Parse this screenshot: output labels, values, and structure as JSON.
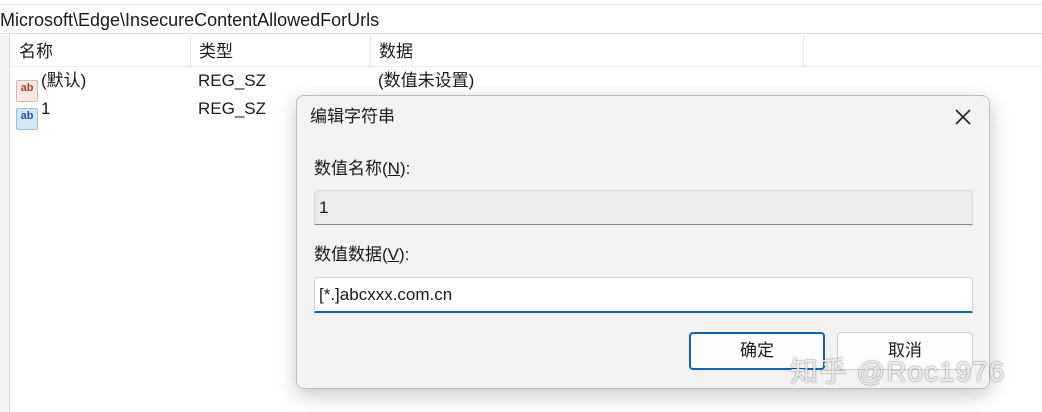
{
  "path": "Microsoft\\Edge\\InsecureContentAllowedForUrls",
  "list": {
    "headers": {
      "name": "名称",
      "type": "类型",
      "data": "数据"
    },
    "rows": [
      {
        "icon": "string-value-icon",
        "name": "(默认)",
        "type": "REG_SZ",
        "data": "(数值未设置)"
      },
      {
        "icon": "string-value-icon",
        "name": "1",
        "type": "REG_SZ",
        "data": ""
      }
    ]
  },
  "dialog": {
    "title": "编辑字符串",
    "value_name_label_pre": "数值名称(",
    "value_name_label_key": "N",
    "value_name_label_post": "):",
    "value_name": "1",
    "value_data_label_pre": "数值数据(",
    "value_data_label_key": "V",
    "value_data_label_post": "):",
    "value_data": "[*.]abcxxx.com.cn",
    "ok_label": "确定",
    "cancel_label": "取消"
  },
  "watermark": "知乎 @Roc1976",
  "colors": {
    "accent": "#0a64c8"
  }
}
